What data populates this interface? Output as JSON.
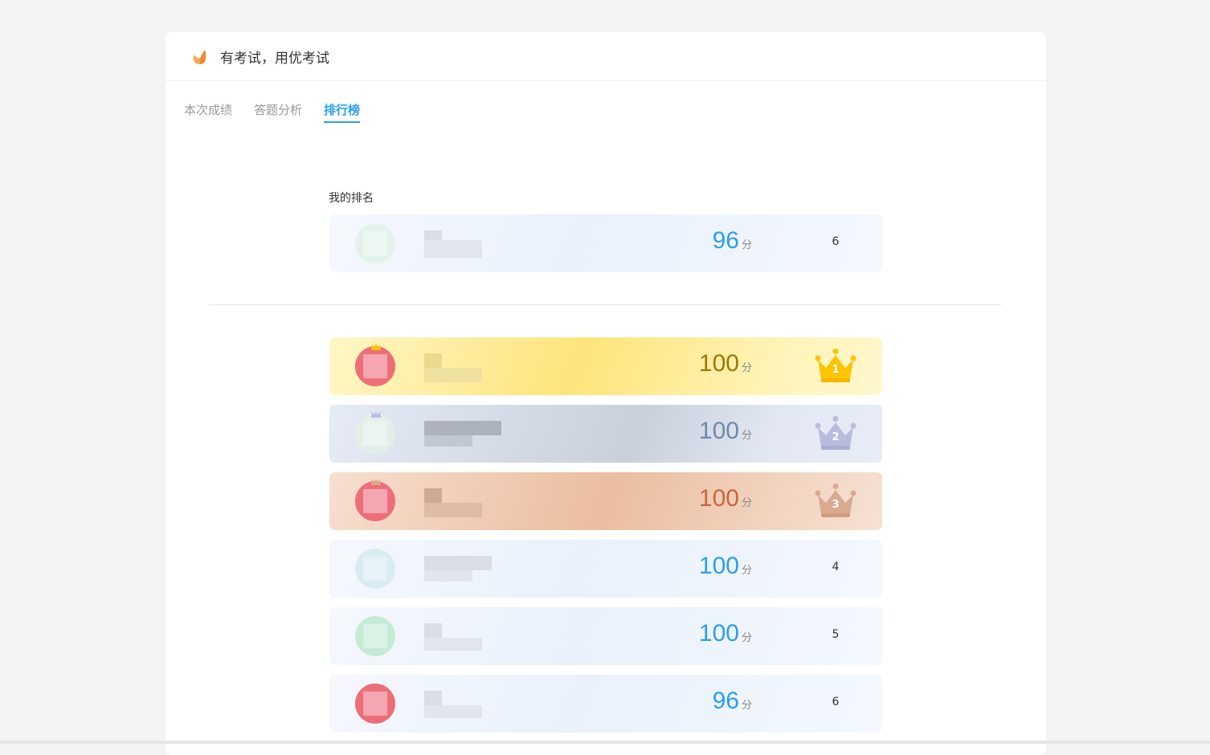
{
  "app": {
    "title": "有考试，用优考试"
  },
  "tabs": [
    {
      "label": "本次成绩",
      "active": false
    },
    {
      "label": "答题分析",
      "active": false
    },
    {
      "label": "排行榜",
      "active": true
    }
  ],
  "my_rank": {
    "label": "我的排名",
    "score": "96",
    "unit": "分",
    "rank": "6"
  },
  "ranking": [
    {
      "score": "100",
      "unit": "分",
      "rank": "1",
      "style": "gold"
    },
    {
      "score": "100",
      "unit": "分",
      "rank": "2",
      "style": "silver"
    },
    {
      "score": "100",
      "unit": "分",
      "rank": "3",
      "style": "bronze"
    },
    {
      "score": "100",
      "unit": "分",
      "rank": "4",
      "style": "plain"
    },
    {
      "score": "100",
      "unit": "分",
      "rank": "5",
      "style": "plain"
    },
    {
      "score": "96",
      "unit": "分",
      "rank": "6",
      "style": "plain"
    }
  ],
  "colors": {
    "accent": "#2a9ff0",
    "gold_score": "#a07800",
    "silver_score": "#6f88ad",
    "bronze_score": "#c8673c",
    "gold_crown": "#ffc400",
    "silver_crown": "#b8bde0",
    "bronze_crown": "#d9aa90"
  }
}
